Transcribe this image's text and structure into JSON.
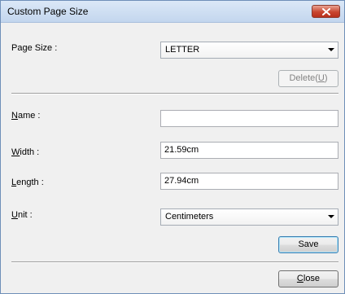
{
  "window": {
    "title": "Custom Page Size"
  },
  "page_size": {
    "label": "Page Size :",
    "value": "LETTER"
  },
  "delete_button": {
    "label": "Delete(",
    "mnemonic": "U",
    "suffix": ")"
  },
  "name": {
    "label_mnemonic": "N",
    "label_rest": "ame :",
    "value": ""
  },
  "width": {
    "label_mnemonic": "W",
    "label_rest": "idth :",
    "value": "21.59cm"
  },
  "length": {
    "label_mnemonic": "L",
    "label_rest": "ength :",
    "value": "27.94cm"
  },
  "unit": {
    "label_mnemonic": "U",
    "label_rest": "nit :",
    "value": "Centimeters"
  },
  "save_button": {
    "label": "Save"
  },
  "close_button": {
    "label_mnemonic": "C",
    "label_rest": "lose"
  }
}
